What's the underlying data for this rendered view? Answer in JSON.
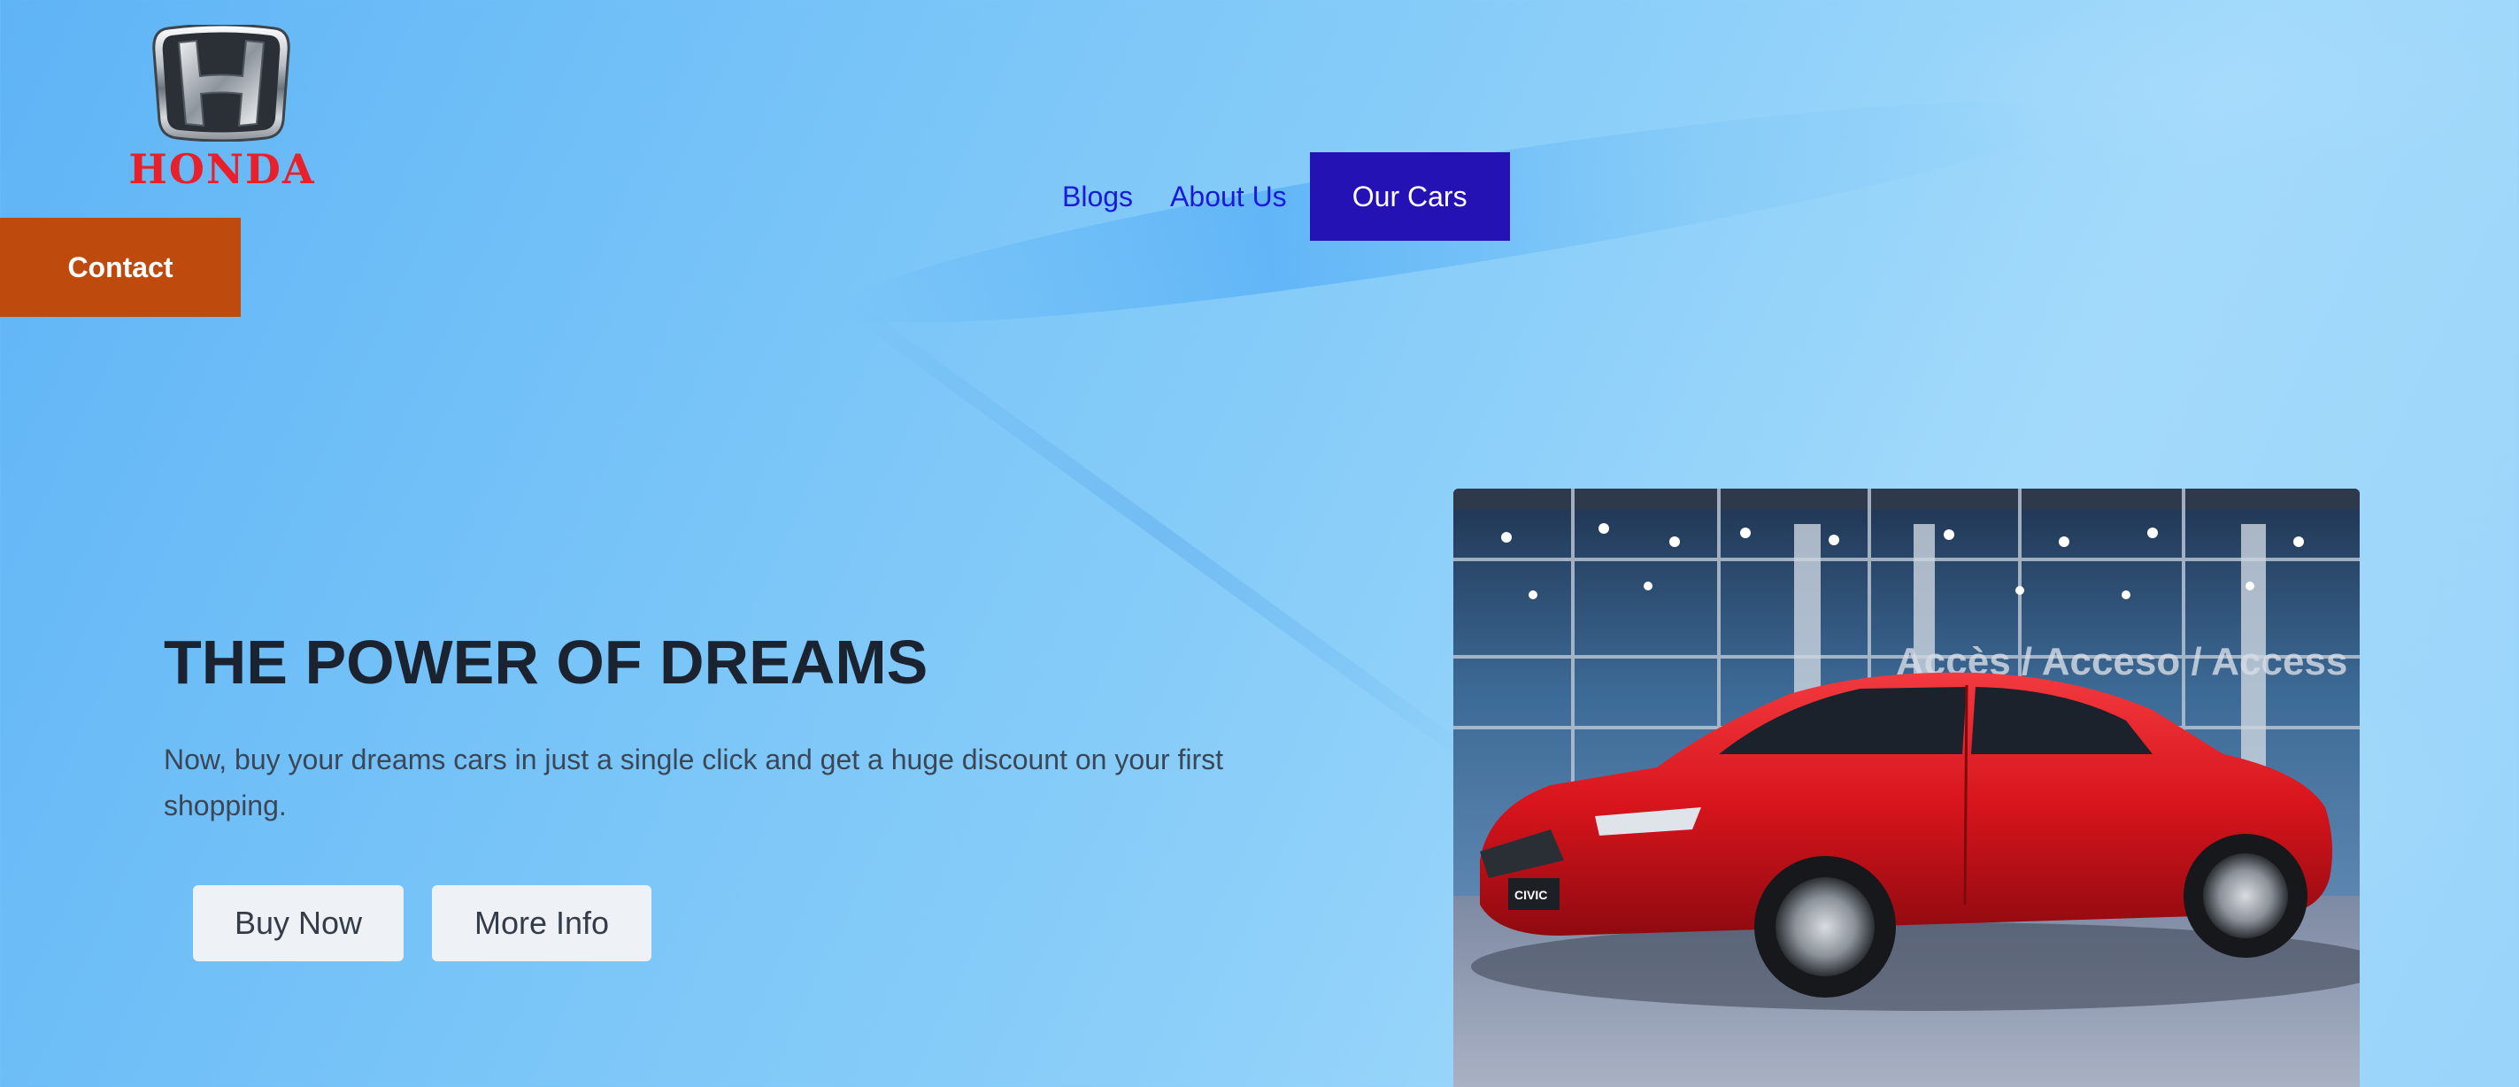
{
  "brand": {
    "name": "HONDA",
    "color": "#e8202a"
  },
  "contact": {
    "label": "Contact",
    "color": "#bf4a0e"
  },
  "nav": {
    "items": [
      {
        "label": "Blogs"
      },
      {
        "label": "About Us"
      }
    ],
    "cta_label": "Our Cars",
    "cta_color": "#2412b4",
    "link_color": "#1a1adb"
  },
  "hero": {
    "title": "THE POWER OF DREAMS",
    "description": "Now, buy your dreams cars in just a single click and get a huge discount on your first shopping.",
    "buttons": {
      "buy_label": "Buy Now",
      "more_label": "More Info"
    }
  },
  "car_image": {
    "signage_text": "Accès / Acceso / Access S",
    "plate_text": "CIVIC",
    "car_color": "#d8141c"
  }
}
